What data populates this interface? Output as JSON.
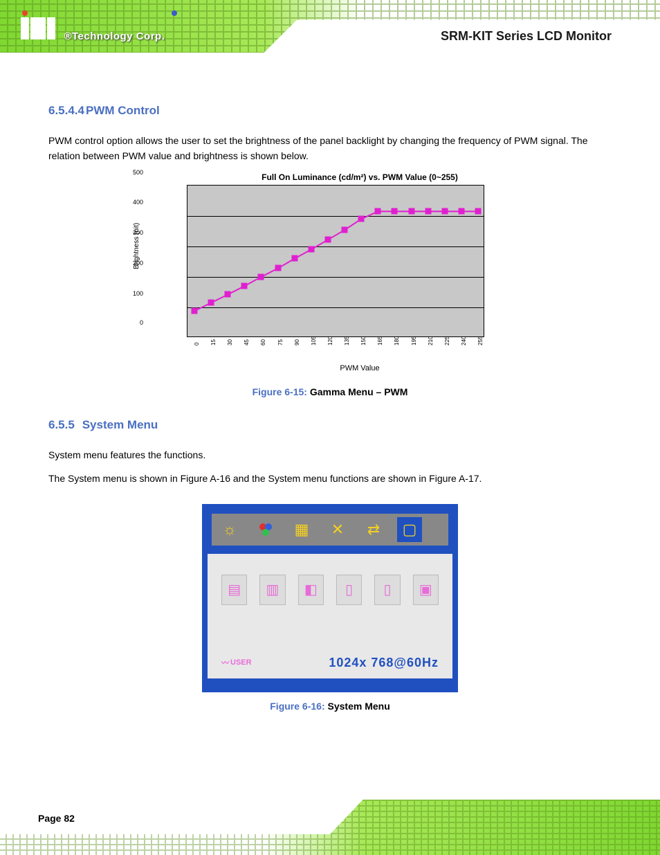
{
  "header": {
    "logo_brand": "®Technology Corp.",
    "product_title": "SRM-KIT Series LCD Monitor"
  },
  "section1": {
    "number": "6.5.4.4",
    "title": "PWM Control",
    "text": "PWM control option allows the user to set the brightness of the panel backlight by changing the frequency of PWM signal. The relation between PWM value and brightness is shown below."
  },
  "figure1": {
    "caption_prefix": "Figure 6-15:",
    "caption": "Gamma Menu – PWM",
    "alt": "PWM settings menu chart"
  },
  "section2": {
    "number": "6.5.5",
    "title": "System Menu",
    "text1": "System menu features the functions.",
    "text2": "The System menu is shown in Figure A-16 and the System menu functions are shown in Figure A-17."
  },
  "osd": {
    "user_label": "USER",
    "resolution": "1024x  768@60Hz",
    "icons": [
      "brightness",
      "color",
      "geometry",
      "tools",
      "io",
      "display"
    ]
  },
  "figure2": {
    "caption_prefix": "Figure 6-16:",
    "caption": "System Menu"
  },
  "footer": {
    "page": "Page 82"
  },
  "chart_data": {
    "type": "line",
    "title": "Full On Luminance (cd/m²) vs. PWM Value (0~255)",
    "xlabel": "PWM Value",
    "ylabel": "Brightness (nit)",
    "ylim": [
      0,
      500
    ],
    "yticks": [
      0,
      100,
      200,
      300,
      400,
      500
    ],
    "x": [
      0,
      15,
      30,
      45,
      60,
      75,
      90,
      105,
      120,
      135,
      150,
      165,
      180,
      195,
      210,
      225,
      240,
      255
    ],
    "values": [
      88,
      115,
      142,
      170,
      200,
      228,
      260,
      290,
      322,
      354,
      390,
      415,
      415,
      415,
      415,
      415,
      415,
      415
    ]
  }
}
